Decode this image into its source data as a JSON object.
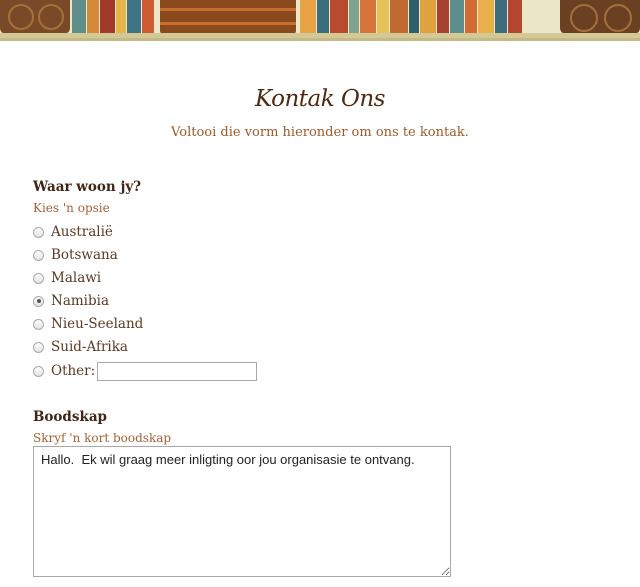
{
  "header": {
    "title": "Kontak Ons",
    "subtitle": "Voltooi die vorm hieronder om ons te kontak."
  },
  "location_question": {
    "label": "Waar woon jy?",
    "help": "Kies 'n opsie",
    "options": [
      {
        "label": "Australië",
        "checked": false
      },
      {
        "label": "Botswana",
        "checked": false
      },
      {
        "label": "Malawi",
        "checked": false
      },
      {
        "label": "Namibia",
        "checked": true
      },
      {
        "label": "Nieu-Seeland",
        "checked": false
      },
      {
        "label": "Suid-Afrika",
        "checked": false
      },
      {
        "label": "Other:",
        "checked": false
      }
    ],
    "other_value": ""
  },
  "message_question": {
    "label": "Boodskap",
    "help": "Skryf 'n kort boodskap",
    "value": "Hallo.  Ek wil graag meer inligting oor jou organisasie te ontvang."
  },
  "colors": {
    "title": "#4e2a12",
    "accent": "#9b5a2a",
    "banner_bg": "#ede7c9"
  }
}
